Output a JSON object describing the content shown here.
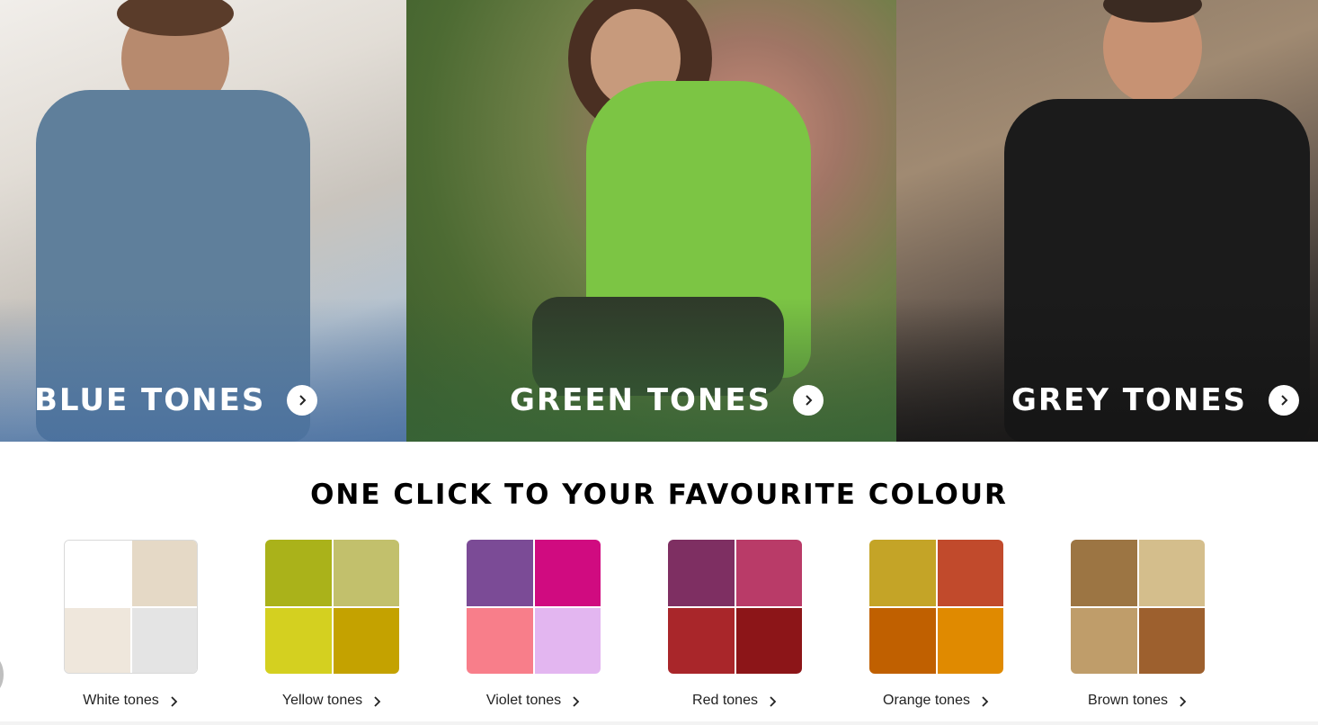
{
  "hero_panels": [
    {
      "id": "blue",
      "label": "BLUE TONES",
      "icon": "chevron-right-icon"
    },
    {
      "id": "green",
      "label": "GREEN TONES",
      "icon": "chevron-right-icon"
    },
    {
      "id": "grey",
      "label": "GREY TONES",
      "icon": "chevron-right-icon"
    }
  ],
  "section": {
    "title": "ONE CLICK TO YOUR FAVOURITE COLOUR"
  },
  "swatches": [
    {
      "label": "White tones",
      "colors": [
        "#ffffff",
        "#e5d9c6",
        "#efe7dc",
        "#e4e4e4"
      ]
    },
    {
      "label": "Yellow tones",
      "colors": [
        "#aab21a",
        "#c2c06c",
        "#d4d020",
        "#c4a200"
      ]
    },
    {
      "label": "Violet tones",
      "colors": [
        "#7b4b96",
        "#d00b80",
        "#f87e8a",
        "#e3b6f0"
      ]
    },
    {
      "label": "Red tones",
      "colors": [
        "#7e2f62",
        "#b93b68",
        "#a9262a",
        "#8c1518"
      ]
    },
    {
      "label": "Orange tones",
      "colors": [
        "#c4a427",
        "#c14a2c",
        "#c06000",
        "#e08a00"
      ]
    },
    {
      "label": "Brown tones",
      "colors": [
        "#9c7543",
        "#d4be8c",
        "#bf9d6a",
        "#9d602e"
      ]
    }
  ]
}
